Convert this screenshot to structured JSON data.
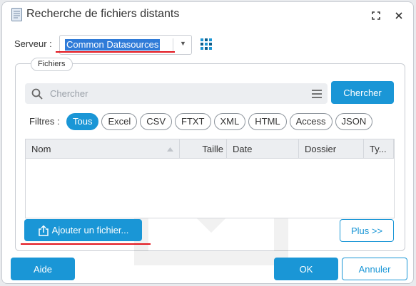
{
  "window": {
    "title": "Recherche de fichiers distants"
  },
  "server": {
    "label": "Serveur :",
    "value": "Common Datasources"
  },
  "files_group": {
    "legend": "Fichiers"
  },
  "search": {
    "placeholder": "Chercher",
    "button_label": "Chercher"
  },
  "filters": {
    "label": "Filtres :",
    "options": [
      "Tous",
      "Excel",
      "CSV",
      "FTXT",
      "XML",
      "HTML",
      "Access",
      "JSON"
    ],
    "active": "Tous"
  },
  "table": {
    "columns": [
      "Nom",
      "Taille",
      "Date",
      "Dossier",
      "Ty..."
    ],
    "rows": []
  },
  "actions": {
    "add_file_label": "Ajouter un fichier...",
    "more_label": "Plus >>",
    "help_label": "Aide",
    "ok_label": "OK",
    "cancel_label": "Annuler"
  },
  "colors": {
    "accent": "#1a96d6",
    "selection": "#2f7bd8",
    "annotation_red": "#e3161e"
  },
  "icons": {
    "title": "file-icon",
    "maximize": "maximize-icon",
    "close": "close-icon",
    "grid": "grid-icon",
    "search": "search-icon",
    "menu": "menu-icon",
    "upload": "upload-icon"
  }
}
